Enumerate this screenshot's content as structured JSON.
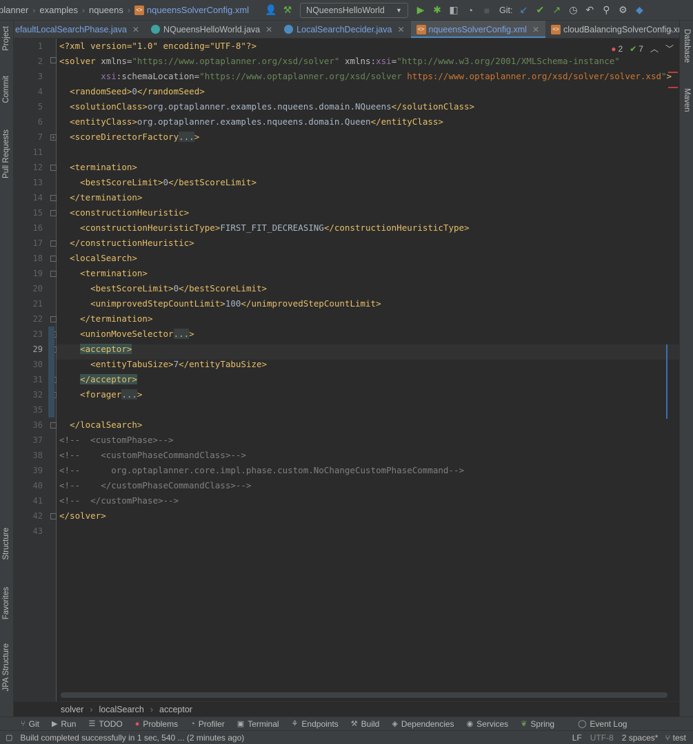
{
  "breadcrumb_top": [
    "planner",
    "examples",
    "nqueens",
    "nqueensSolverConfig.xml"
  ],
  "run_config": "NQueensHelloWorld",
  "git_label": "Git:",
  "tabs": [
    {
      "label": "efaultLocalSearchPhase.java",
      "kind": "java"
    },
    {
      "label": "NQueensHelloWorld.java",
      "kind": "class"
    },
    {
      "label": "LocalSearchDecider.java",
      "kind": "java"
    },
    {
      "label": "nqueensSolverConfig.xml",
      "kind": "xml",
      "active": true
    },
    {
      "label": "cloudBalancingSolverConfig.xml",
      "kind": "xml"
    }
  ],
  "left_tools": [
    "Project",
    "Commit",
    "Pull Requests",
    "Structure",
    "Favorites",
    "JPA Structure"
  ],
  "right_tools": [
    "Database",
    "Maven"
  ],
  "inspection": {
    "errors": "2",
    "warnings": "7"
  },
  "line_numbers": [
    "1",
    "2",
    "3",
    "4",
    "5",
    "6",
    "7",
    "11",
    "12",
    "13",
    "14",
    "15",
    "16",
    "17",
    "18",
    "19",
    "20",
    "21",
    "22",
    "23",
    "29",
    "30",
    "31",
    "32",
    "35",
    "36",
    "37",
    "38",
    "39",
    "40",
    "41",
    "42",
    "43"
  ],
  "code": {
    "l1_decl": "<?xml version=\"1.0\" encoding=\"UTF-8\"?>",
    "l2_a": "<solver ",
    "l2_b": "xmlns",
    "l2_c": "=",
    "l2_d": "\"https://www.optaplanner.org/xsd/solver\"",
    "l2_e": " xmlns:",
    "l2_f": "xsi",
    "l2_g": "=",
    "l2_h": "\"http://www.w3.org/2001/XMLSchema-instance\"",
    "l3_a": "xsi",
    "l3_b": ":schemaLocation=",
    "l3_c": "\"https://www.optaplanner.org/xsd/solver ",
    "l3_d": "https://www.optaplanner.org/xsd/solver/solver.xsd",
    "l3_e": "\"",
    "l3_f": ">",
    "l4_a": "<randomSeed>",
    "l4_b": "0",
    "l4_c": "</randomSeed>",
    "l5_a": "<solutionClass>",
    "l5_b": "org.optaplanner.examples.nqueens.domain.NQueens",
    "l5_c": "</solutionClass>",
    "l6_a": "<entityClass>",
    "l6_b": "org.optaplanner.examples.nqueens.domain.Queen",
    "l6_c": "</entityClass>",
    "l7_a": "<scoreDirectorFactory",
    "l7_b": "...",
    "l7_c": ">",
    "l12": "<termination>",
    "l13_a": "<bestScoreLimit>",
    "l13_b": "0",
    "l13_c": "</bestScoreLimit>",
    "l14": "</termination>",
    "l15": "<constructionHeuristic>",
    "l16_a": "<constructionHeuristicType>",
    "l16_b": "FIRST_FIT_DECREASING",
    "l16_c": "</constructionHeuristicType>",
    "l17": "</constructionHeuristic>",
    "l18": "<localSearch>",
    "l19": "<termination>",
    "l20_a": "<bestScoreLimit>",
    "l20_b": "0",
    "l20_c": "</bestScoreLimit>",
    "l21_a": "<unimprovedStepCountLimit>",
    "l21_b": "100",
    "l21_c": "</unimprovedStepCountLimit>",
    "l22": "</termination>",
    "l23_a": "<unionMoveSelector",
    "l23_b": "...",
    "l23_c": ">",
    "l29": "<acceptor>",
    "l30_a": "<entityTabuSize>",
    "l30_b": "7",
    "l30_c": "</entityTabuSize>",
    "l31": "</acceptor>",
    "l32_a": "<forager",
    "l32_b": "...",
    "l32_c": ">",
    "l36": "</localSearch>",
    "l37": "<!--  <customPhase>-->",
    "l38": "<!--    <customPhaseCommandClass>-->",
    "l39": "<!--      org.optaplanner.core.impl.phase.custom.NoChangeCustomPhaseCommand-->",
    "l40": "<!--    </customPhaseCommandClass>-->",
    "l41": "<!--  </customPhase>-->",
    "l42": "</solver>"
  },
  "bottom_breadcrumb": [
    "solver",
    "localSearch",
    "acceptor"
  ],
  "tool_windows": [
    "Git",
    "Run",
    "TODO",
    "Problems",
    "Profiler",
    "Terminal",
    "Endpoints",
    "Build",
    "Dependencies",
    "Services",
    "Spring",
    "Event Log"
  ],
  "status": {
    "message": "Build completed successfully in 1 sec, 540 ... (2 minutes ago)",
    "line_sep": "LF",
    "encoding": "UTF-8",
    "indent": "2 spaces*",
    "vcs": "test"
  },
  "colors": {
    "accent": "#4a88c7",
    "tag": "#e8bf6a",
    "string": "#6a8759",
    "comment": "#808080",
    "error": "#e05555",
    "ok": "#62b543"
  }
}
